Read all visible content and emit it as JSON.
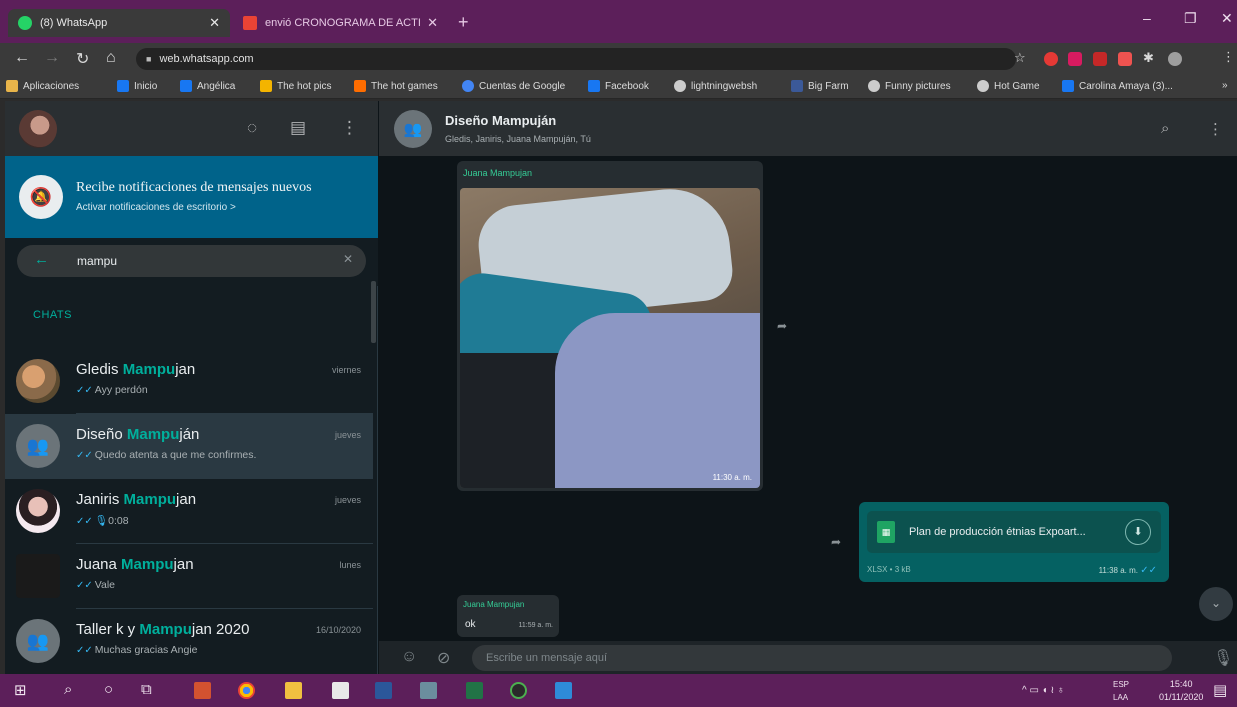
{
  "browser": {
    "tabs": [
      {
        "label": "(8) WhatsApp",
        "active": true,
        "color": "#25d366"
      },
      {
        "label": "envió CRONOGRAMA DE ACTIV",
        "active": false,
        "color": "#ea4335"
      }
    ],
    "url": "web.whatsapp.com",
    "bookmarks": [
      {
        "label": "Aplicaciones",
        "color": "#e8b44a"
      },
      {
        "label": "Inicio",
        "color": "#1877f2"
      },
      {
        "label": "Angélica",
        "color": "#1877f2"
      },
      {
        "label": "The hot pics",
        "color": "#f4b400"
      },
      {
        "label": "The hot games",
        "color": "#ff6d00"
      },
      {
        "label": "Cuentas de Google",
        "color": "#4285f4"
      },
      {
        "label": "Facebook",
        "color": "#1877f2"
      },
      {
        "label": "lightningwebsh",
        "color": "#cccccc"
      },
      {
        "label": "Big Farm",
        "color": "#3b5998"
      },
      {
        "label": "Funny pictures",
        "color": "#cccccc"
      },
      {
        "label": "Hot Game",
        "color": "#cccccc"
      },
      {
        "label": "Carolina Amaya (3)...",
        "color": "#1877f2"
      }
    ]
  },
  "whatsapp": {
    "notification": {
      "title": "Recibe notificaciones de mensajes nuevos",
      "link": "Activar notificaciones de escritorio >"
    },
    "search": {
      "value": "mampu"
    },
    "chats_label": "CHATS",
    "chats": [
      {
        "prefix": "Gledis ",
        "highlight": "Mampu",
        "suffix": "jan",
        "time": "viernes",
        "preview": "Ayy perdón",
        "selected": false
      },
      {
        "prefix": "Diseño ",
        "highlight": "Mampu",
        "suffix": "ján",
        "time": "jueves",
        "preview": "Quedo atenta a que me confirmes.",
        "selected": true
      },
      {
        "prefix": "Janiris ",
        "highlight": "Mampu",
        "suffix": "jan",
        "time": "jueves",
        "preview": "0:08",
        "selected": false
      },
      {
        "prefix": "Juana ",
        "highlight": "Mampu",
        "suffix": "jan",
        "time": "lunes",
        "preview": "Vale",
        "selected": false
      },
      {
        "prefix": "Taller k y ",
        "highlight": "Mampu",
        "suffix": "jan 2020",
        "time": "16/10/2020",
        "preview": "Muchas gracias Angie",
        "selected": false
      }
    ],
    "conversation": {
      "title": "Diseño Mampuján",
      "members": "Gledis, Janiris, Juana Mampuján, Tú",
      "messages": {
        "image": {
          "sender": "Juana Mampujan",
          "time": "11:30 a. m."
        },
        "file": {
          "name": "Plan de producción étnias Expoart...",
          "meta": "XLSX • 3 kB",
          "time": "11:38 a. m."
        },
        "text": {
          "sender": "Juana Mampujan",
          "text": "ok",
          "time": "11:59 a. m."
        }
      },
      "composer_placeholder": "Escribe un mensaje aquí"
    }
  },
  "taskbar": {
    "lang": [
      "ESP",
      "LAA"
    ],
    "time": "15:40",
    "date": "01/11/2020"
  }
}
